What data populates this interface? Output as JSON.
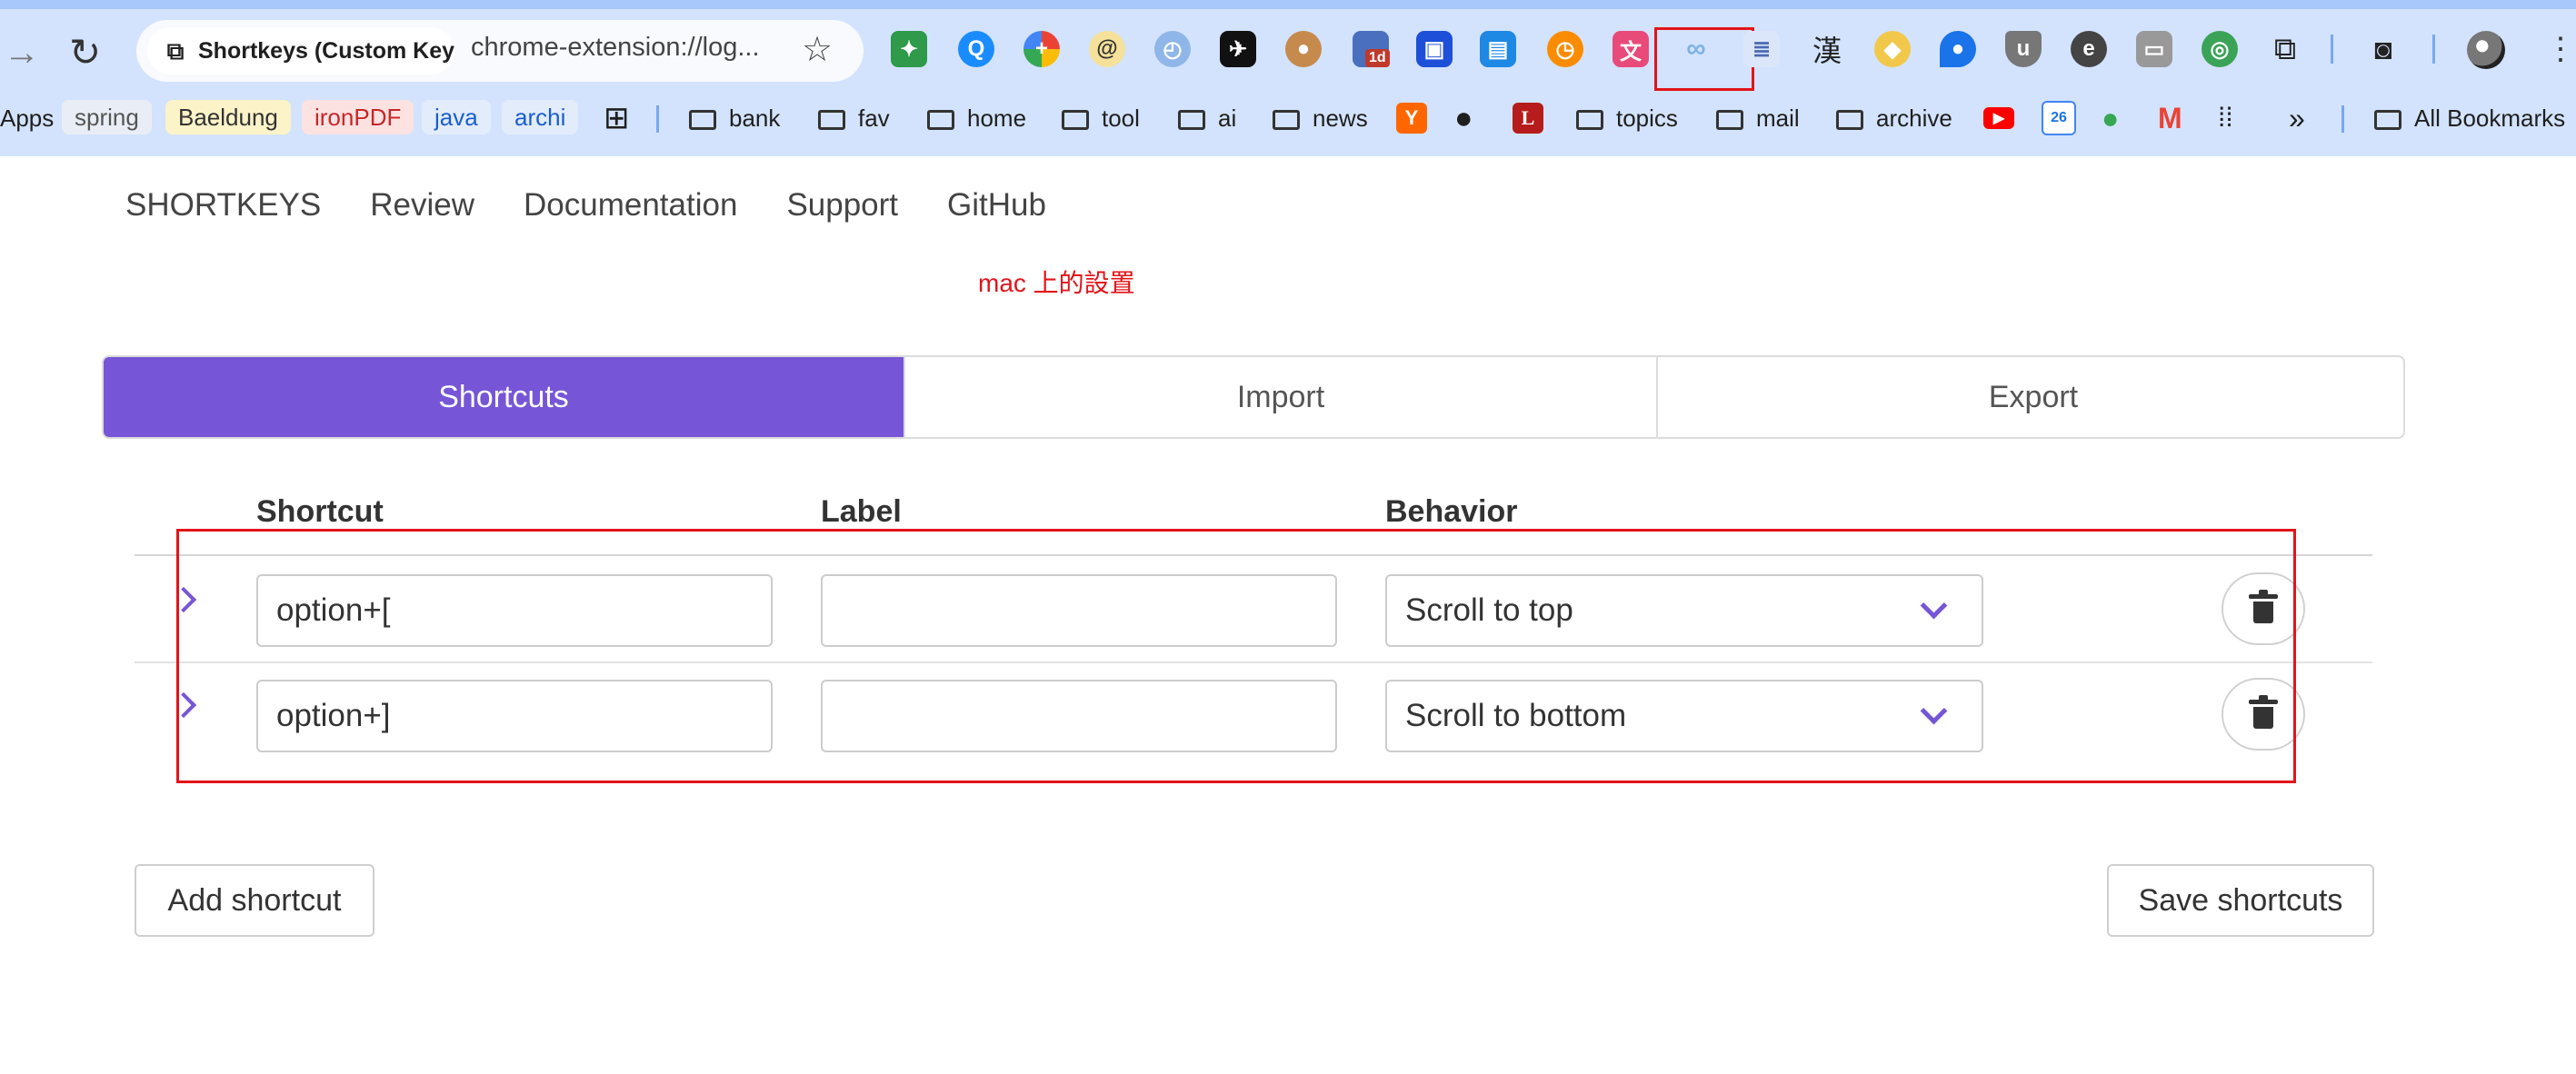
{
  "browser": {
    "tab_title": "Shortkeys (Custom Keyb",
    "url": "chrome-extension://log...",
    "bookmarks": {
      "apps": "Apps",
      "spring": "spring",
      "baeldung": "Baeldung",
      "ironpdf": "ironPDF",
      "java": "java",
      "archi": "archi",
      "bank": "bank",
      "fav": "fav",
      "home": "home",
      "tool": "tool",
      "ai": "ai",
      "news": "news",
      "topics": "topics",
      "mail": "mail",
      "archive": "archive",
      "all_bookmarks": "All Bookmarks",
      "overflow": "»"
    },
    "extension_glyphs": {
      "kanji": "漢",
      "calendar_badge": "1d",
      "gcal_day": "26"
    }
  },
  "site_nav": [
    "SHORTKEYS",
    "Review",
    "Documentation",
    "Support",
    "GitHub"
  ],
  "annotation_note": "mac 上的設置",
  "tabs": [
    "Shortcuts",
    "Import",
    "Export"
  ],
  "table": {
    "headers": {
      "shortcut": "Shortcut",
      "label": "Label",
      "behavior": "Behavior"
    },
    "rows": [
      {
        "shortcut": "option+[",
        "label": "",
        "behavior": "Scroll to top"
      },
      {
        "shortcut": "option+]",
        "label": "",
        "behavior": "Scroll to bottom"
      }
    ]
  },
  "actions": {
    "add": "Add shortcut",
    "save": "Save shortcuts"
  },
  "colors": {
    "accent": "#7656d6",
    "annotation": "#e2141a",
    "chrome": "#d3e3fd"
  }
}
